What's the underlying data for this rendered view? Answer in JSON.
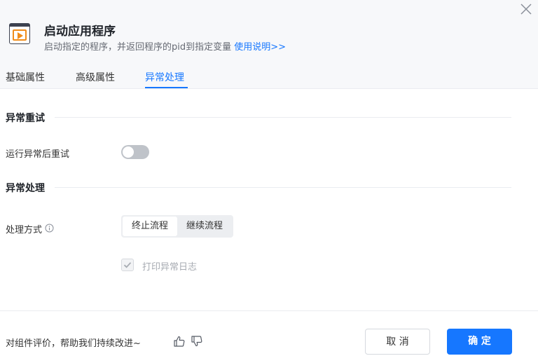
{
  "header": {
    "title": "启动应用程序",
    "subtitle": "启动指定的程序，并返回程序的pid到指定变量",
    "help_link": "使用说明>>"
  },
  "tabs": [
    {
      "label": "基础属性",
      "active": false
    },
    {
      "label": "高级属性",
      "active": false
    },
    {
      "label": "异常处理",
      "active": true
    }
  ],
  "sections": {
    "retry": {
      "title": "异常重试",
      "retry_label": "运行异常后重试",
      "retry_enabled": false
    },
    "handling": {
      "title": "异常处理",
      "method_label": "处理方式",
      "options": [
        "终止流程",
        "继续流程"
      ],
      "selected_option": "终止流程",
      "log_label": "打印异常日志",
      "log_checked": true,
      "log_disabled": true
    }
  },
  "footer": {
    "feedback_text": "对组件评价，帮助我们持续改进~",
    "cancel_label": "取 消",
    "ok_label": "确 定"
  },
  "colors": {
    "accent": "#1677ff",
    "icon_orange": "#f08c1a",
    "toggle_off": "#bfc3c9"
  }
}
